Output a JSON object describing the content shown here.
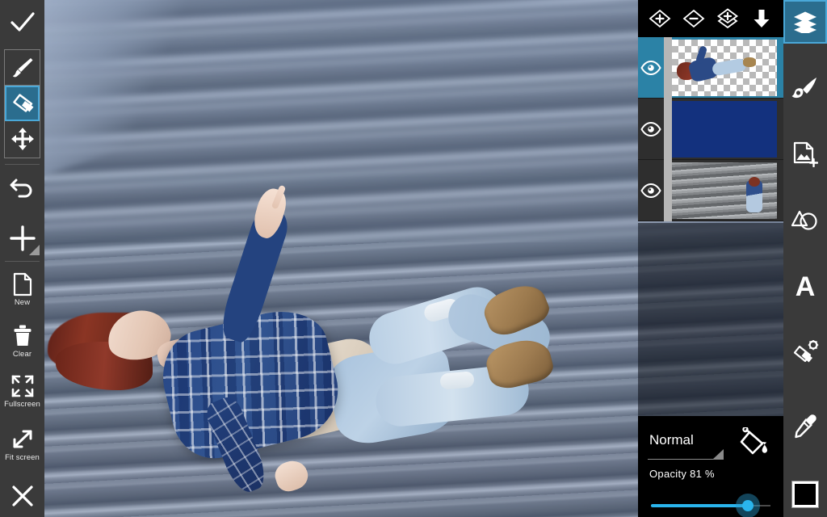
{
  "app": {
    "name": "photo-editor",
    "accent_teal": "#2b6d8e",
    "accent_border": "#4aa8d8",
    "slider_blue": "#2ab4ec",
    "panel_dark": "#3a3a3a",
    "panel_black": "#000000"
  },
  "left_toolbar": {
    "confirm_label": "",
    "confirm_icon": "check-icon",
    "tools": [
      {
        "id": "brush",
        "icon": "paintbrush-icon",
        "label": "",
        "selected": false
      },
      {
        "id": "eraser",
        "icon": "eraser-icon",
        "label": "",
        "selected": true
      },
      {
        "id": "move",
        "icon": "move-arrows-icon",
        "label": "",
        "selected": false
      }
    ],
    "actions": [
      {
        "id": "undo",
        "icon": "undo-arrow-icon",
        "label": ""
      },
      {
        "id": "add",
        "icon": "plus-icon",
        "label": ""
      },
      {
        "id": "new",
        "icon": "new-document-icon",
        "label": "New"
      },
      {
        "id": "clear",
        "icon": "trash-icon",
        "label": "Clear"
      },
      {
        "id": "fullscreen",
        "icon": "fullscreen-icon",
        "label": "Fullscreen"
      },
      {
        "id": "fit-screen",
        "icon": "fit-screen-icon",
        "label": "Fit screen"
      },
      {
        "id": "close",
        "icon": "close-x-icon",
        "label": ""
      }
    ]
  },
  "right_toolbar": {
    "items": [
      {
        "id": "layers",
        "icon": "layers-icon",
        "selected": true
      },
      {
        "id": "brush",
        "icon": "brush-stroke-icon",
        "selected": false
      },
      {
        "id": "add-image",
        "icon": "add-photo-icon",
        "selected": false
      },
      {
        "id": "shapes",
        "icon": "shapes-icon",
        "selected": false
      },
      {
        "id": "text",
        "icon": "text-a-icon",
        "selected": false,
        "glyph": "A"
      },
      {
        "id": "eraser-settings",
        "icon": "eraser-gear-icon",
        "selected": false
      },
      {
        "id": "color-picker",
        "icon": "eyedropper-icon",
        "selected": false
      }
    ],
    "color_swatch": {
      "id": "current-color",
      "value": "#000000"
    }
  },
  "layers_panel": {
    "toolbar": [
      {
        "id": "add-layer",
        "icon": "diamond-plus-icon"
      },
      {
        "id": "remove-layer",
        "icon": "diamond-minus-icon"
      },
      {
        "id": "duplicate-layer",
        "icon": "double-diamond-plus-icon"
      },
      {
        "id": "merge-down",
        "icon": "arrow-down-icon"
      }
    ],
    "layers": [
      {
        "id": "layer-1",
        "thumb": "cutout-person-transparent",
        "visible": true,
        "selected": true,
        "eye_icon": "eye-icon"
      },
      {
        "id": "layer-2",
        "thumb": "solid-navy-blue",
        "visible": true,
        "selected": false,
        "eye_icon": "eye-icon"
      },
      {
        "id": "layer-3",
        "thumb": "stairs-photo",
        "visible": true,
        "selected": false,
        "eye_icon": "eye-icon"
      }
    ],
    "blend": {
      "mode_label": "Normal",
      "dropdown_icon": "dropdown-triangle-icon",
      "bucket_icon": "paint-bucket-icon"
    },
    "opacity": {
      "label": "Opacity  81 %",
      "value": 81,
      "min": 0,
      "max": 100
    }
  },
  "canvas": {
    "id": "editing-canvas",
    "description": "composited image: woman floating horizontally above concrete stairs with blue tint layer"
  }
}
